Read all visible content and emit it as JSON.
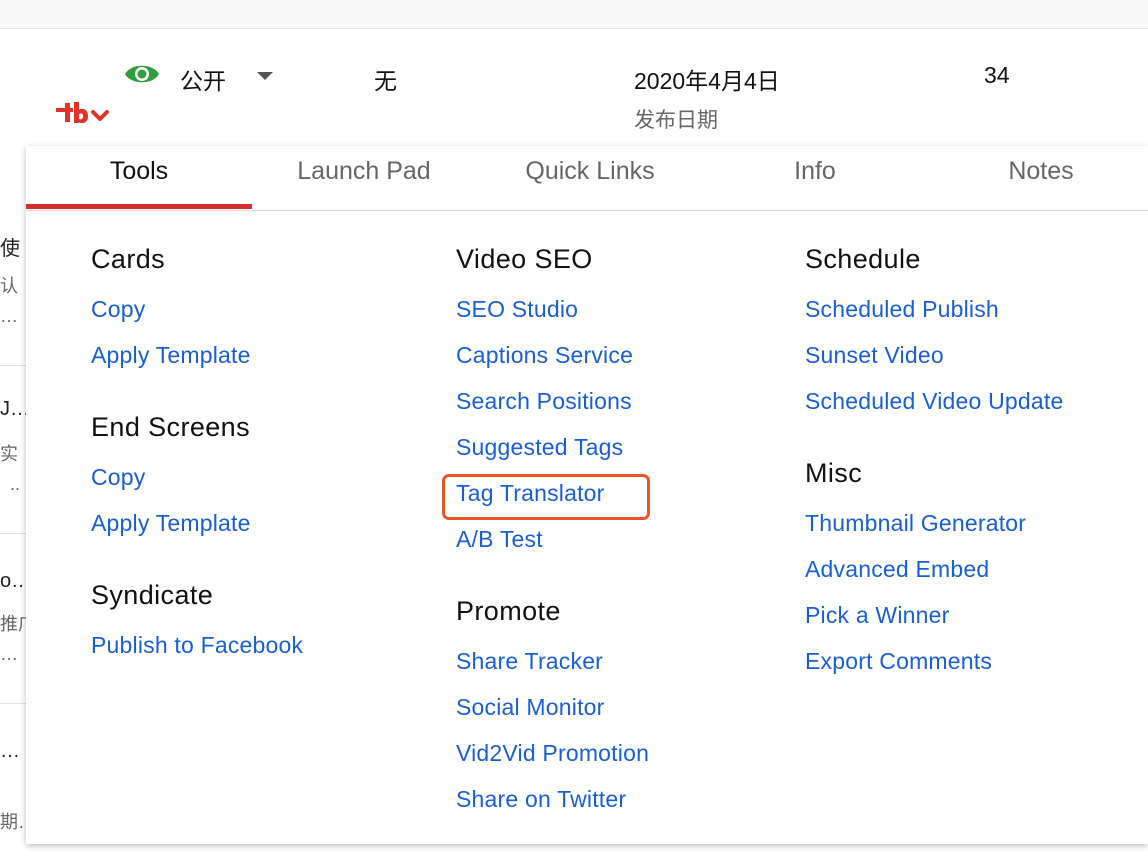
{
  "video_row": {
    "visibility": "公开",
    "restrictions": "无",
    "date": "2020年4月4日",
    "date_label": "发布日期",
    "views": "34"
  },
  "background_fragments": [
    "使",
    "认",
    "…",
    "J…",
    "实",
    "..",
    "o…",
    "推广",
    "…",
    "…",
    "期…"
  ],
  "tabs": [
    {
      "label": "Tools",
      "active": true
    },
    {
      "label": "Launch Pad",
      "active": false
    },
    {
      "label": "Quick Links",
      "active": false
    },
    {
      "label": "Info",
      "active": false
    },
    {
      "label": "Notes",
      "active": false
    }
  ],
  "columns": {
    "col1": {
      "cards": {
        "title": "Cards",
        "links": [
          "Copy",
          "Apply Template"
        ]
      },
      "end_screens": {
        "title": "End Screens",
        "links": [
          "Copy",
          "Apply Template"
        ]
      },
      "syndicate": {
        "title": "Syndicate",
        "links": [
          "Publish to Facebook"
        ]
      }
    },
    "col2": {
      "video_seo": {
        "title": "Video SEO",
        "links": [
          "SEO Studio",
          "Captions Service",
          "Search Positions",
          "Suggested Tags",
          "Tag Translator",
          "A/B Test"
        ]
      },
      "promote": {
        "title": "Promote",
        "links": [
          "Share Tracker",
          "Social Monitor",
          "Vid2Vid Promotion",
          "Share on Twitter"
        ]
      }
    },
    "col3": {
      "schedule": {
        "title": "Schedule",
        "links": [
          "Scheduled Publish",
          "Sunset Video",
          "Scheduled Video Update"
        ]
      },
      "misc": {
        "title": "Misc",
        "links": [
          "Thumbnail Generator",
          "Advanced Embed",
          "Pick a Winner",
          "Export Comments"
        ]
      }
    }
  },
  "colors": {
    "accent": "#d32f2f",
    "link": "#1a5fd1",
    "highlight": "#e6562a",
    "visibility_icon": "#2e9e3e"
  },
  "icons": {
    "visibility": "eye-icon",
    "dropdown": "caret-down-icon",
    "logo": "tubebuddy-logo-icon"
  }
}
